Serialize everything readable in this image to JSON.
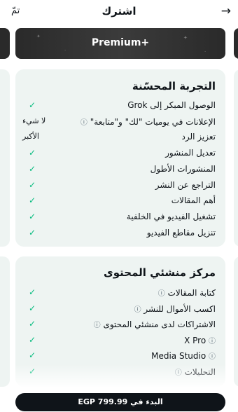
{
  "header": {
    "back_icon": "→",
    "title": "اشترك",
    "done": "تمّ"
  },
  "banner": {
    "label": "Premium+"
  },
  "card1": {
    "title": "التجربة المحسّنة",
    "rows": [
      {
        "feature": "الوصول المبكر إلى Grok",
        "info": false,
        "value": "✓",
        "is_check": true
      },
      {
        "feature": "الإعلانات في يوميات \"لك\" و\"متابعة\"",
        "info": true,
        "value": "لا شيء",
        "is_check": false
      },
      {
        "feature": "تعزيز الرد",
        "info": false,
        "value": "الأكبر",
        "is_check": false
      },
      {
        "feature": "تعديل المنشور",
        "info": false,
        "value": "✓",
        "is_check": true
      },
      {
        "feature": "المنشورات الأطول",
        "info": false,
        "value": "✓",
        "is_check": true
      },
      {
        "feature": "التراجع عن النشر",
        "info": false,
        "value": "✓",
        "is_check": true
      },
      {
        "feature": "أهم المقالات",
        "info": false,
        "value": "✓",
        "is_check": true
      },
      {
        "feature": "تشغيل الفيديو في الخلفية",
        "info": false,
        "value": "✓",
        "is_check": true
      },
      {
        "feature": "تنزيل مقاطع الفيديو",
        "info": false,
        "value": "✓",
        "is_check": true
      }
    ]
  },
  "card2": {
    "title": "مركز منشئي المحتوى",
    "rows": [
      {
        "feature": "كتابة المقالات",
        "info": true,
        "value": "✓",
        "is_check": true
      },
      {
        "feature": "اكسب الأموال للنشر",
        "info": true,
        "value": "✓",
        "is_check": true
      },
      {
        "feature": "الاشتراكات لدى منشئي المحتوى",
        "info": true,
        "value": "✓",
        "is_check": true
      },
      {
        "feature": "X Pro",
        "info": true,
        "value": "✓",
        "is_check": true
      },
      {
        "feature": "Media Studio",
        "info": true,
        "value": "✓",
        "is_check": true
      },
      {
        "feature": "التحليلات",
        "info": true,
        "value": "✓",
        "is_check": true
      }
    ]
  },
  "info_icon": "ⓘ",
  "cta": {
    "label": "البدء في EGP 799.99"
  },
  "colors": {
    "accent_check": "#00ba7c",
    "card_bg": "#eef4f2",
    "cta_bg": "#0f1419"
  }
}
